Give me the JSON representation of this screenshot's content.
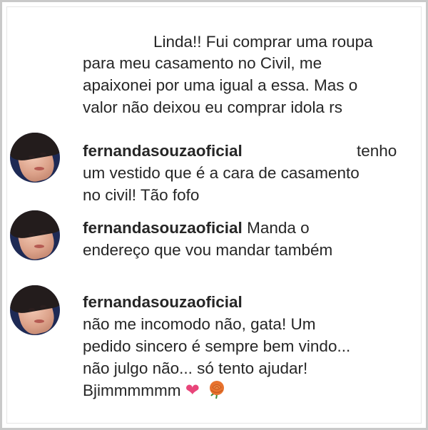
{
  "comments": [
    {
      "username": "",
      "lines": [
        "Linda!! Fui comprar uma roupa",
        "para meu casamento no Civil, me",
        "apaixonei por uma igual a essa. Mas o",
        "valor não deixou eu comprar idola rs"
      ]
    },
    {
      "username": "fernandasouzaoficial",
      "first_line_rest": "tenho",
      "lines": [
        "um vestido que é a cara de casamento",
        "no civil! Tão fofo"
      ]
    },
    {
      "username": "fernandasouzaoficial",
      "first_line_rest": "Manda o",
      "lines": [
        "endereço que vou mandar também"
      ]
    },
    {
      "username": "fernandasouzaoficial",
      "lines": [
        "não me incomodo não, gata! Um",
        "pedido sincero é sempre bem vindo...",
        "não julgo não... só tento ajudar!",
        "Bjimmmmmm"
      ],
      "emoji": [
        "heart-emoji",
        "rose-emoji"
      ]
    }
  ],
  "colors": {
    "text": "#262626",
    "heart": "#e8457a",
    "rose": "#e8732e",
    "avatar_bg": "#1e2a55"
  }
}
